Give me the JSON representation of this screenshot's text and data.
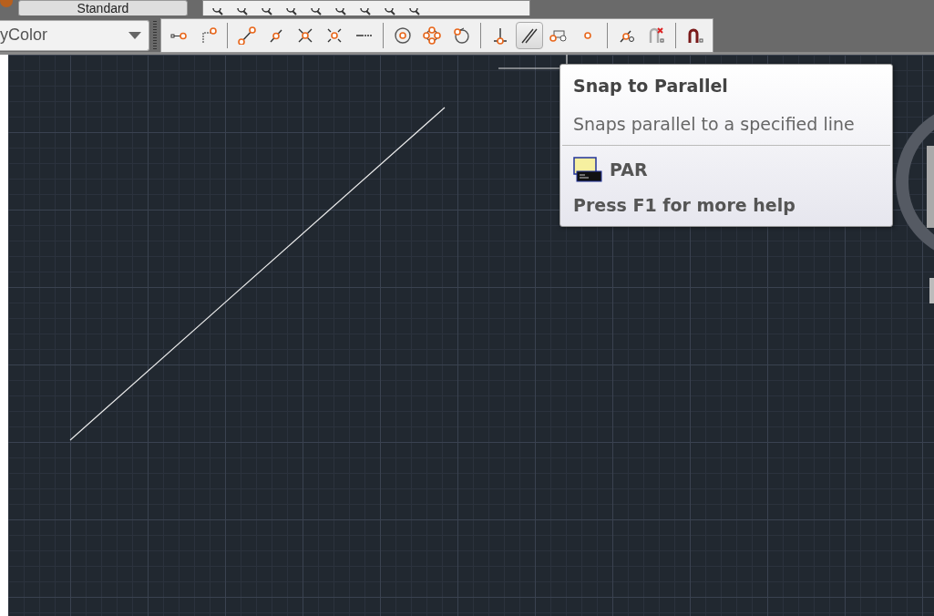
{
  "style_toolbar": {
    "style_combo": {
      "value": "Standard"
    }
  },
  "properties_toolbar": {
    "color_combo": {
      "value": "yColor"
    }
  },
  "osnap_toolbar": {
    "groups": [
      [
        {
          "selected": false
        },
        {
          "selected": false
        }
      ],
      [
        {
          "selected": false
        },
        {
          "selected": false
        },
        {
          "selected": false
        },
        {
          "selected": false
        },
        {
          "selected": false
        }
      ],
      [
        {
          "selected": false
        },
        {
          "selected": false
        },
        {
          "selected": false
        }
      ],
      [
        {
          "selected": false
        },
        {
          "selected": true
        },
        {
          "selected": false
        },
        {
          "selected": false
        }
      ],
      [
        {
          "selected": false
        },
        {
          "selected": false
        }
      ],
      [
        {
          "selected": false
        }
      ]
    ]
  },
  "tooltip": {
    "title": "Snap to Parallel",
    "description": "Snaps parallel to a specified line",
    "command": "PAR",
    "help": "Press F1 for more help"
  }
}
